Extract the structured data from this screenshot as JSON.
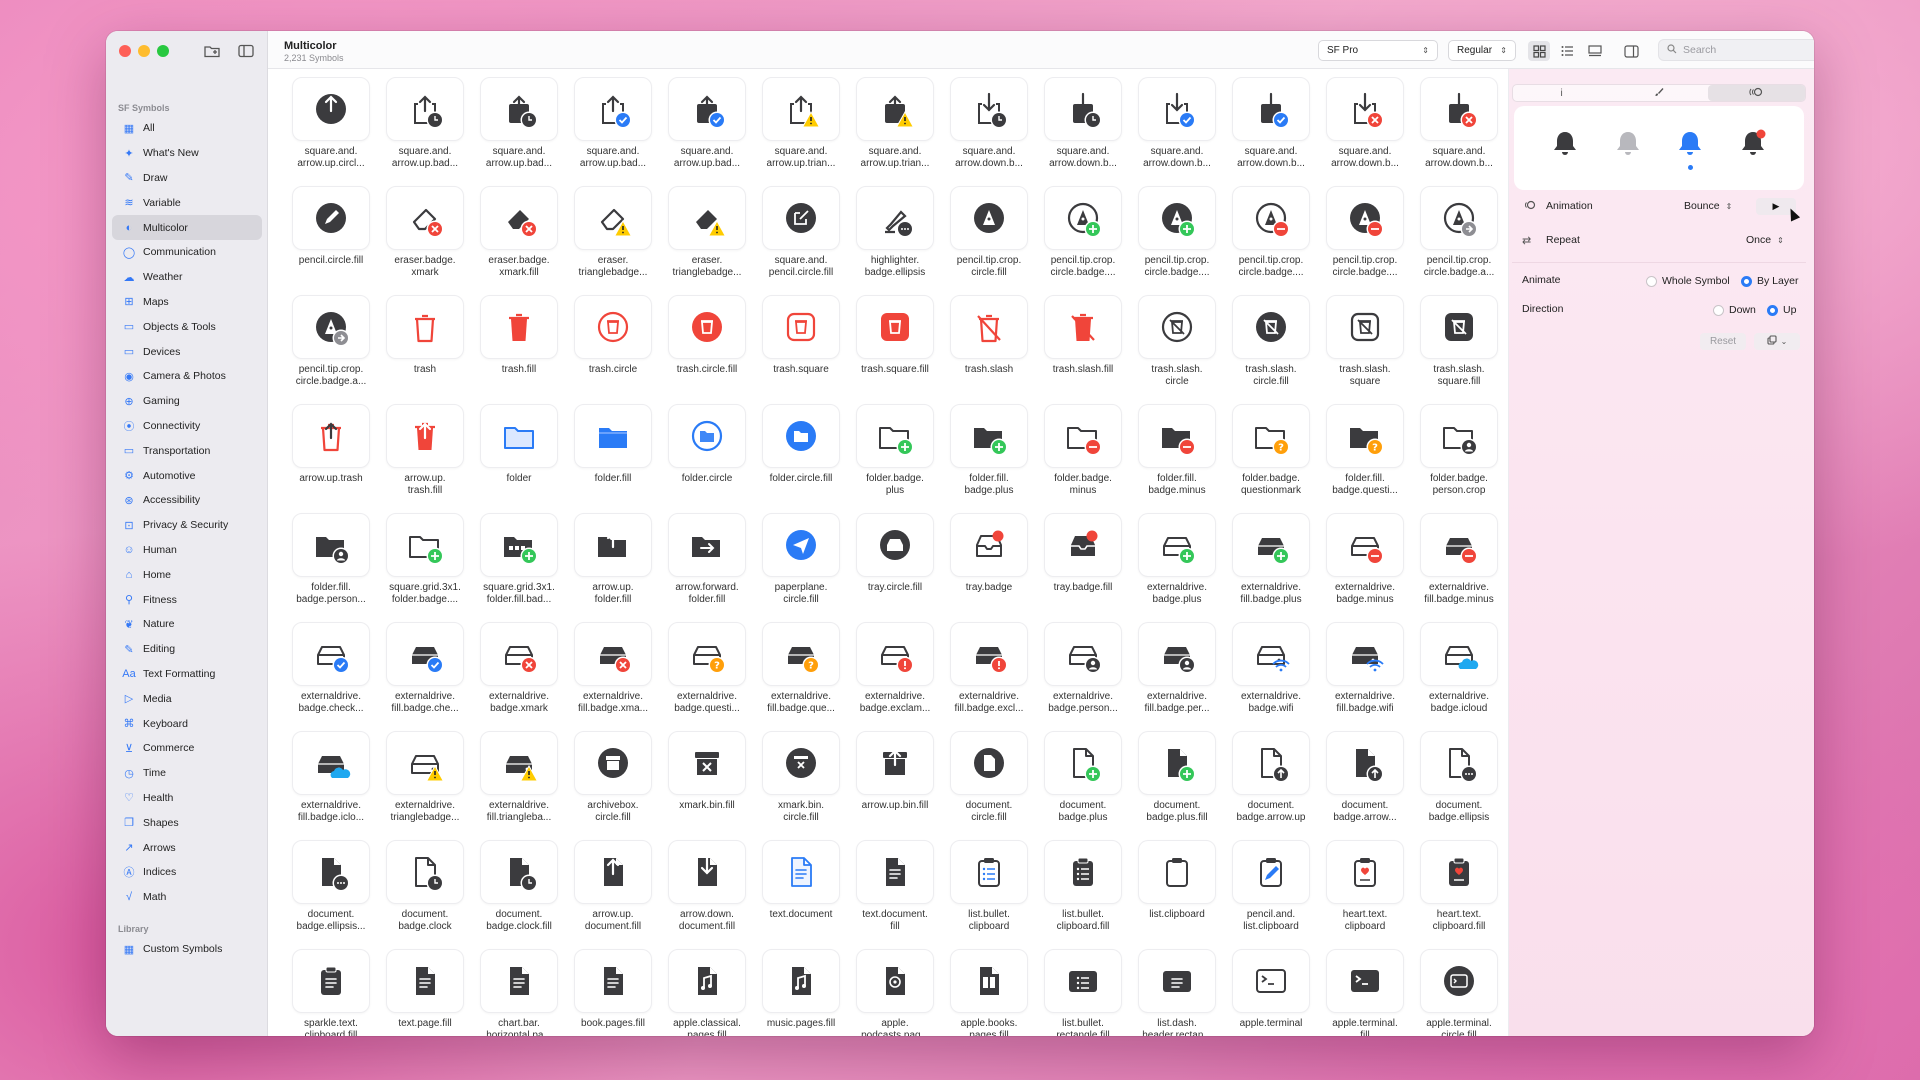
{
  "window": {
    "title": "Multicolor",
    "subtitle": "2,231 Symbols"
  },
  "sidebar": {
    "section_label": "SF Symbols",
    "items": [
      {
        "label": "All",
        "icon": "grid-icon",
        "active": false
      },
      {
        "label": "What's New",
        "icon": "sparkles-icon",
        "active": false
      },
      {
        "label": "Draw",
        "icon": "pencil-icon",
        "active": false
      },
      {
        "label": "Variable",
        "icon": "slider-icon",
        "active": false
      },
      {
        "label": "Multicolor",
        "icon": "palette-icon",
        "active": true
      },
      {
        "label": "Communication",
        "icon": "bubble-icon",
        "active": false
      },
      {
        "label": "Weather",
        "icon": "cloud-icon",
        "active": false
      },
      {
        "label": "Maps",
        "icon": "map-icon",
        "active": false
      },
      {
        "label": "Objects & Tools",
        "icon": "folder-icon",
        "active": false
      },
      {
        "label": "Devices",
        "icon": "desktop-icon",
        "active": false
      },
      {
        "label": "Camera & Photos",
        "icon": "camera-icon",
        "active": false
      },
      {
        "label": "Gaming",
        "icon": "gamecontroller-icon",
        "active": false
      },
      {
        "label": "Connectivity",
        "icon": "antenna-icon",
        "active": false
      },
      {
        "label": "Transportation",
        "icon": "car-icon",
        "active": false
      },
      {
        "label": "Automotive",
        "icon": "engine-icon",
        "active": false
      },
      {
        "label": "Accessibility",
        "icon": "accessibility-icon",
        "active": false
      },
      {
        "label": "Privacy & Security",
        "icon": "lock-icon",
        "active": false
      },
      {
        "label": "Human",
        "icon": "person-icon",
        "active": false
      },
      {
        "label": "Home",
        "icon": "house-icon",
        "active": false
      },
      {
        "label": "Fitness",
        "icon": "figure-icon",
        "active": false
      },
      {
        "label": "Nature",
        "icon": "leaf-icon",
        "active": false
      },
      {
        "label": "Editing",
        "icon": "pencil-tip-icon",
        "active": false
      },
      {
        "label": "Text Formatting",
        "icon": "textformat-icon",
        "active": false
      },
      {
        "label": "Media",
        "icon": "playpause-icon",
        "active": false
      },
      {
        "label": "Keyboard",
        "icon": "command-icon",
        "active": false
      },
      {
        "label": "Commerce",
        "icon": "cart-icon",
        "active": false
      },
      {
        "label": "Time",
        "icon": "clock-icon",
        "active": false
      },
      {
        "label": "Health",
        "icon": "heart-icon",
        "active": false
      },
      {
        "label": "Shapes",
        "icon": "square-stack-icon",
        "active": false
      },
      {
        "label": "Arrows",
        "icon": "arrow-icon",
        "active": false
      },
      {
        "label": "Indices",
        "icon": "a-circle-icon",
        "active": false
      },
      {
        "label": "Math",
        "icon": "sqrt-icon",
        "active": false
      }
    ],
    "library_label": "Library",
    "library_items": [
      {
        "label": "Custom Symbols",
        "icon": "custom-grid-icon"
      }
    ]
  },
  "toolbar": {
    "font_value": "SF Pro",
    "weight_value": "Regular",
    "search_placeholder": "Search"
  },
  "symbols": [
    {
      "label": "square.and.\narrow.up.circl...",
      "shape": "circle",
      "glyph": "up",
      "badge": ""
    },
    {
      "label": "square.and.\narrow.up.bad...",
      "shape": "share",
      "glyph": "up",
      "badge": "clock"
    },
    {
      "label": "square.and.\narrow.up.bad...",
      "shape": "sharefill",
      "glyph": "up",
      "badge": "clock"
    },
    {
      "label": "square.and.\narrow.up.bad...",
      "shape": "share",
      "glyph": "up",
      "badge": "check"
    },
    {
      "label": "square.and.\narrow.up.bad...",
      "shape": "sharefill",
      "glyph": "up",
      "badge": "check"
    },
    {
      "label": "square.and.\narrow.up.trian...",
      "shape": "share",
      "glyph": "up",
      "badge": "warn"
    },
    {
      "label": "square.and.\narrow.up.trian...",
      "shape": "sharefill",
      "glyph": "up",
      "badge": "warn"
    },
    {
      "label": "square.and.\narrow.down.b...",
      "shape": "share",
      "glyph": "down",
      "badge": "clock"
    },
    {
      "label": "square.and.\narrow.down.b...",
      "shape": "sharefill",
      "glyph": "down",
      "badge": "clock"
    },
    {
      "label": "square.and.\narrow.down.b...",
      "shape": "share",
      "glyph": "down",
      "badge": "check"
    },
    {
      "label": "square.and.\narrow.down.b...",
      "shape": "sharefill",
      "glyph": "down",
      "badge": "check"
    },
    {
      "label": "square.and.\narrow.down.b...",
      "shape": "share",
      "glyph": "down",
      "badge": "x"
    },
    {
      "label": "square.and.\narrow.down.b...",
      "shape": "sharefill",
      "glyph": "down",
      "badge": "x"
    },
    {
      "label": "pencil.circle.fill",
      "shape": "circle",
      "glyph": "pencil",
      "badge": ""
    },
    {
      "label": "eraser.badge.\nxmark",
      "shape": "eraser",
      "glyph": "",
      "badge": "x"
    },
    {
      "label": "eraser.badge.\nxmark.fill",
      "shape": "eraserfill",
      "glyph": "",
      "badge": "x"
    },
    {
      "label": "eraser.\ntrianglebadge...",
      "shape": "eraser",
      "glyph": "",
      "badge": "warn"
    },
    {
      "label": "eraser.\ntrianglebadge...",
      "shape": "eraserfill",
      "glyph": "",
      "badge": "warn"
    },
    {
      "label": "square.and.\npencil.circle.fill",
      "shape": "circle",
      "glyph": "sqpencil",
      "badge": ""
    },
    {
      "label": "highlighter.\nbadge.ellipsis",
      "shape": "highlighter",
      "glyph": "",
      "badge": "dots"
    },
    {
      "label": "pencil.tip.crop.\ncircle.fill",
      "shape": "circle",
      "glyph": "tip",
      "badge": ""
    },
    {
      "label": "pencil.tip.crop.\ncircle.badge....",
      "shape": "ring",
      "glyph": "tip",
      "badge": "plus"
    },
    {
      "label": "pencil.tip.crop.\ncircle.badge....",
      "shape": "circle",
      "glyph": "tip",
      "badge": "plus"
    },
    {
      "label": "pencil.tip.crop.\ncircle.badge....",
      "shape": "ring",
      "glyph": "tip",
      "badge": "minus"
    },
    {
      "label": "pencil.tip.crop.\ncircle.badge....",
      "shape": "circle",
      "glyph": "tip",
      "badge": "minus"
    },
    {
      "label": "pencil.tip.crop.\ncircle.badge.a...",
      "shape": "ring",
      "glyph": "tip",
      "badge": "arrow"
    },
    {
      "label": "pencil.tip.crop.\ncircle.badge.a...",
      "shape": "circle",
      "glyph": "tip",
      "badge": "arrow"
    },
    {
      "label": "trash",
      "shape": "trash",
      "glyph": "",
      "badge": ""
    },
    {
      "label": "trash.fill",
      "shape": "trashfill",
      "glyph": "",
      "badge": ""
    },
    {
      "label": "trash.circle",
      "shape": "redring",
      "glyph": "trash",
      "badge": ""
    },
    {
      "label": "trash.circle.fill",
      "shape": "redcircle",
      "glyph": "trash",
      "badge": ""
    },
    {
      "label": "trash.square",
      "shape": "redsqring",
      "glyph": "trash",
      "badge": ""
    },
    {
      "label": "trash.square.fill",
      "shape": "redsquare",
      "glyph": "trash",
      "badge": ""
    },
    {
      "label": "trash.slash",
      "shape": "trash",
      "glyph": "slash",
      "badge": ""
    },
    {
      "label": "trash.slash.fill",
      "shape": "trashfill",
      "glyph": "slash",
      "badge": ""
    },
    {
      "label": "trash.slash.\ncircle",
      "shape": "ring",
      "glyph": "trashslash",
      "badge": ""
    },
    {
      "label": "trash.slash.\ncircle.fill",
      "shape": "circle",
      "glyph": "trashslash",
      "badge": ""
    },
    {
      "label": "trash.slash.\nsquare",
      "shape": "sqring",
      "glyph": "trashslash",
      "badge": ""
    },
    {
      "label": "trash.slash.\nsquare.fill",
      "shape": "square",
      "glyph": "trashslash",
      "badge": ""
    },
    {
      "label": "arrow.up.trash",
      "shape": "trash",
      "glyph": "up",
      "badge": ""
    },
    {
      "label": "arrow.up.\ntrash.fill",
      "shape": "trashfill",
      "glyph": "up",
      "badge": ""
    },
    {
      "label": "folder",
      "shape": "folder",
      "glyph": "",
      "badge": ""
    },
    {
      "label": "folder.fill",
      "shape": "folderfill",
      "glyph": "",
      "badge": ""
    },
    {
      "label": "folder.circle",
      "shape": "bluering",
      "glyph": "folder",
      "badge": ""
    },
    {
      "label": "folder.circle.fill",
      "shape": "bluecircle",
      "glyph": "folder",
      "badge": ""
    },
    {
      "label": "folder.badge.\nplus",
      "shape": "grayfolder",
      "glyph": "",
      "badge": "plus"
    },
    {
      "label": "folder.fill.\nbadge.plus",
      "shape": "grayfolderfill",
      "glyph": "",
      "badge": "plus"
    },
    {
      "label": "folder.badge.\nminus",
      "shape": "grayfolder",
      "glyph": "",
      "badge": "minus"
    },
    {
      "label": "folder.fill.\nbadge.minus",
      "shape": "grayfolderfill",
      "glyph": "",
      "badge": "minus"
    },
    {
      "label": "folder.badge.\nquestionmark",
      "shape": "grayfolder",
      "glyph": "",
      "badge": "question"
    },
    {
      "label": "folder.fill.\nbadge.questi...",
      "shape": "grayfolderfill",
      "glyph": "",
      "badge": "question"
    },
    {
      "label": "folder.badge.\nperson.crop",
      "shape": "grayfolder",
      "glyph": "",
      "badge": "person"
    },
    {
      "label": "folder.fill.\nbadge.person...",
      "shape": "grayfolderfill",
      "glyph": "",
      "badge": "person"
    },
    {
      "label": "square.grid.3x1.\nfolder.badge....",
      "shape": "grayfolder",
      "glyph": "dots3",
      "badge": "plus"
    },
    {
      "label": "square.grid.3x1.\nfolder.fill.bad...",
      "shape": "grayfolderfill",
      "glyph": "dots3",
      "badge": "plus"
    },
    {
      "label": "arrow.up.\nfolder.fill",
      "shape": "grayfolderfill",
      "glyph": "up",
      "badge": ""
    },
    {
      "label": "arrow.forward.\nfolder.fill",
      "shape": "grayfolderfill",
      "glyph": "right",
      "badge": ""
    },
    {
      "label": "paperplane.\ncircle.fill",
      "shape": "bluecircle",
      "glyph": "plane",
      "badge": ""
    },
    {
      "label": "tray.circle.fill",
      "shape": "circle",
      "glyph": "tray",
      "badge": ""
    },
    {
      "label": "tray.badge",
      "shape": "tray",
      "glyph": "",
      "badge": "reddot"
    },
    {
      "label": "tray.badge.fill",
      "shape": "trayfill",
      "glyph": "",
      "badge": "reddot"
    },
    {
      "label": "externaldrive.\nbadge.plus",
      "shape": "drive",
      "glyph": "",
      "badge": "plus"
    },
    {
      "label": "externaldrive.\nfill.badge.plus",
      "shape": "drivefill",
      "glyph": "",
      "badge": "plus"
    },
    {
      "label": "externaldrive.\nbadge.minus",
      "shape": "drive",
      "glyph": "",
      "badge": "minus"
    },
    {
      "label": "externaldrive.\nfill.badge.minus",
      "shape": "drivefill",
      "glyph": "",
      "badge": "minus"
    },
    {
      "label": "externaldrive.\nbadge.check...",
      "shape": "drive",
      "glyph": "",
      "badge": "check"
    },
    {
      "label": "externaldrive.\nfill.badge.che...",
      "shape": "drivefill",
      "glyph": "",
      "badge": "check"
    },
    {
      "label": "externaldrive.\nbadge.xmark",
      "shape": "drive",
      "glyph": "",
      "badge": "x"
    },
    {
      "label": "externaldrive.\nfill.badge.xma...",
      "shape": "drivefill",
      "glyph": "",
      "badge": "x"
    },
    {
      "label": "externaldrive.\nbadge.questi...",
      "shape": "drive",
      "glyph": "",
      "badge": "question"
    },
    {
      "label": "externaldrive.\nfill.badge.que...",
      "shape": "drivefill",
      "glyph": "",
      "badge": "question"
    },
    {
      "label": "externaldrive.\nbadge.exclam...",
      "shape": "drive",
      "glyph": "",
      "badge": "exclaim"
    },
    {
      "label": "externaldrive.\nfill.badge.excl...",
      "shape": "drivefill",
      "glyph": "",
      "badge": "exclaim"
    },
    {
      "label": "externaldrive.\nbadge.person...",
      "shape": "drive",
      "glyph": "",
      "badge": "person"
    },
    {
      "label": "externaldrive.\nfill.badge.per...",
      "shape": "drivefill",
      "glyph": "",
      "badge": "person"
    },
    {
      "label": "externaldrive.\nbadge.wifi",
      "shape": "drive",
      "glyph": "",
      "badge": "wifi"
    },
    {
      "label": "externaldrive.\nfill.badge.wifi",
      "shape": "drivefill",
      "glyph": "",
      "badge": "wifi"
    },
    {
      "label": "externaldrive.\nbadge.icloud",
      "shape": "drive",
      "glyph": "",
      "badge": "cloud"
    },
    {
      "label": "externaldrive.\nfill.badge.iclo...",
      "shape": "drivefill",
      "glyph": "",
      "badge": "cloud"
    },
    {
      "label": "externaldrive.\ntrianglebadge...",
      "shape": "drive",
      "glyph": "",
      "badge": "warn"
    },
    {
      "label": "externaldrive.\nfill.triangleba...",
      "shape": "drivefill",
      "glyph": "",
      "badge": "warn"
    },
    {
      "label": "archivebox.\ncircle.fill",
      "shape": "circle",
      "glyph": "box",
      "badge": ""
    },
    {
      "label": "xmark.bin.fill",
      "shape": "bin",
      "glyph": "x",
      "badge": ""
    },
    {
      "label": "xmark.bin.\ncircle.fill",
      "shape": "circle",
      "glyph": "binx",
      "badge": ""
    },
    {
      "label": "arrow.up.bin.fill",
      "shape": "bin",
      "glyph": "up",
      "badge": ""
    },
    {
      "label": "document.\ncircle.fill",
      "shape": "circle",
      "glyph": "doc",
      "badge": ""
    },
    {
      "label": "document.\nbadge.plus",
      "shape": "doc",
      "glyph": "",
      "badge": "plus"
    },
    {
      "label": "document.\nbadge.plus.fill",
      "shape": "docfill",
      "glyph": "",
      "badge": "plus"
    },
    {
      "label": "document.\nbadge.arrow.up",
      "shape": "doc",
      "glyph": "",
      "badge": "uparrow"
    },
    {
      "label": "document.\nbadge.arrow...",
      "shape": "docfill",
      "glyph": "",
      "badge": "uparrow"
    },
    {
      "label": "document.\nbadge.ellipsis",
      "shape": "doc",
      "glyph": "",
      "badge": "dots"
    },
    {
      "label": "document.\nbadge.ellipsis...",
      "shape": "docfill",
      "glyph": "",
      "badge": "dots"
    },
    {
      "label": "document.\nbadge.clock",
      "shape": "doc",
      "glyph": "",
      "badge": "clock"
    },
    {
      "label": "document.\nbadge.clock.fill",
      "shape": "docfill",
      "glyph": "",
      "badge": "clock"
    },
    {
      "label": "arrow.up.\ndocument.fill",
      "shape": "docfill",
      "glyph": "up",
      "badge": ""
    },
    {
      "label": "arrow.down.\ndocument.fill",
      "shape": "docfill",
      "glyph": "down",
      "badge": ""
    },
    {
      "label": "text.document",
      "shape": "bluedoc",
      "glyph": "lines",
      "badge": ""
    },
    {
      "label": "text.document.\nfill",
      "shape": "docfill",
      "glyph": "lines",
      "badge": ""
    },
    {
      "label": "list.bullet.\nclipboard",
      "shape": "clip",
      "glyph": "bullets",
      "badge": ""
    },
    {
      "label": "list.bullet.\nclipboard.fill",
      "shape": "clipfill",
      "glyph": "bullets",
      "badge": ""
    },
    {
      "label": "list.clipboard",
      "shape": "clip",
      "glyph": "lines",
      "badge": ""
    },
    {
      "label": "pencil.and.\nlist.clipboard",
      "shape": "clip",
      "glyph": "bluepencil",
      "badge": ""
    },
    {
      "label": "heart.text.\nclipboard",
      "shape": "clip",
      "glyph": "heart",
      "badge": ""
    },
    {
      "label": "heart.text.\nclipboard.fill",
      "shape": "clipfill",
      "glyph": "heart",
      "badge": ""
    },
    {
      "label": "sparkle.text.\nclipboard.fill",
      "shape": "clipfill",
      "glyph": "lines",
      "badge": ""
    },
    {
      "label": "text.page.fill",
      "shape": "docfill",
      "glyph": "lines",
      "badge": ""
    },
    {
      "label": "chart.bar.\nhorizontal.pa...",
      "shape": "docfill",
      "glyph": "lines",
      "badge": ""
    },
    {
      "label": "book.pages.fill",
      "shape": "docfill",
      "glyph": "lines",
      "badge": ""
    },
    {
      "label": "apple.classical.\npages.fill",
      "shape": "docfill",
      "glyph": "music",
      "badge": ""
    },
    {
      "label": "music.pages.fill",
      "shape": "docfill",
      "glyph": "music",
      "badge": ""
    },
    {
      "label": "apple.\npodcasts.pag...",
      "shape": "docfill",
      "glyph": "pod",
      "badge": ""
    },
    {
      "label": "apple.books.\npages.fill",
      "shape": "docfill",
      "glyph": "book",
      "badge": ""
    },
    {
      "label": "list.bullet.\nrectangle.fill",
      "shape": "rectfill",
      "glyph": "bullets",
      "badge": ""
    },
    {
      "label": "list.dash.\nheader.rectan...",
      "shape": "rectfill",
      "glyph": "lines",
      "badge": ""
    },
    {
      "label": "apple.terminal",
      "shape": "term",
      "glyph": "",
      "badge": ""
    },
    {
      "label": "apple.terminal.\nfill",
      "shape": "termfill",
      "glyph": "",
      "badge": ""
    },
    {
      "label": "apple.terminal.\ncircle.fill",
      "shape": "circle",
      "glyph": "prompt",
      "badge": ""
    }
  ],
  "inspector": {
    "tabs": [
      {
        "label": "i",
        "icon": "info-icon"
      },
      {
        "label": "",
        "icon": "paintbrush-icon"
      },
      {
        "label": "",
        "icon": "animation-icon"
      }
    ],
    "preview_selected_index": 2,
    "animation_label": "Animation",
    "animation_value": "Bounce",
    "repeat_label": "Repeat",
    "repeat_value": "Once",
    "animate_label": "Animate",
    "animate_options": [
      "Whole Symbol",
      "By Layer"
    ],
    "animate_selected": "By Layer",
    "direction_label": "Direction",
    "direction_options": [
      "Down",
      "Up"
    ],
    "direction_selected": "Up",
    "reset_label": "Reset",
    "play_icon": "play-icon"
  },
  "colors": {
    "accent": "#2a7bf6",
    "red": "#f0453a",
    "green": "#34c759",
    "yellow": "#ffcc00",
    "orange": "#ff9f0a",
    "gray": "#3b3b3e"
  }
}
